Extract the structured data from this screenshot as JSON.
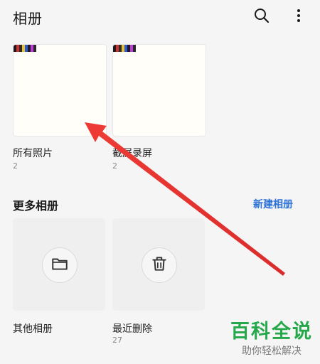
{
  "header": {
    "title": "相册",
    "icons": [
      "search-icon",
      "more-vertical-icon"
    ]
  },
  "albums": [
    {
      "name": "所有照片",
      "count": "2"
    },
    {
      "name": "截屏录屏",
      "count": "2"
    }
  ],
  "more_albums": {
    "title": "更多相册",
    "new_album_label": "新建相册",
    "items": [
      {
        "name": "其他相册",
        "count": "",
        "icon": "folder-icon"
      },
      {
        "name": "最近删除",
        "count": "27",
        "icon": "trash-icon"
      }
    ]
  },
  "watermark": {
    "title": "百科全说",
    "subtitle": "助你轻松解决"
  },
  "colors": {
    "accent": "#2b70d6",
    "arrow": "#e53935",
    "watermark": "#25a84a"
  }
}
